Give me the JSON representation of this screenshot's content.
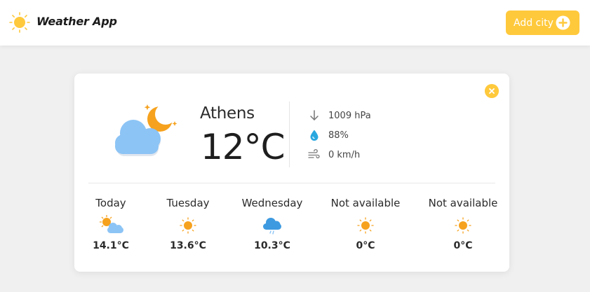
{
  "header": {
    "app_title": "Weather App",
    "add_city_label": "Add city",
    "accent_color": "#ffc93c"
  },
  "card": {
    "city": "Athens",
    "temperature": "12°C",
    "condition_icon": "cloud-moon-icon",
    "stats": {
      "pressure": "1009 hPa",
      "humidity": "88%",
      "wind": "0 km/h"
    },
    "forecast": [
      {
        "day": "Today",
        "temp": "14.1°C",
        "icon": "sun-cloud-icon"
      },
      {
        "day": "Tuesday",
        "temp": "13.6°C",
        "icon": "sun-icon"
      },
      {
        "day": "Wednesday",
        "temp": "10.3°C",
        "icon": "rain-cloud-icon"
      },
      {
        "day": "Not available",
        "temp": "0°C",
        "icon": "sun-icon"
      },
      {
        "day": "Not available",
        "temp": "0°C",
        "icon": "sun-icon"
      }
    ]
  }
}
